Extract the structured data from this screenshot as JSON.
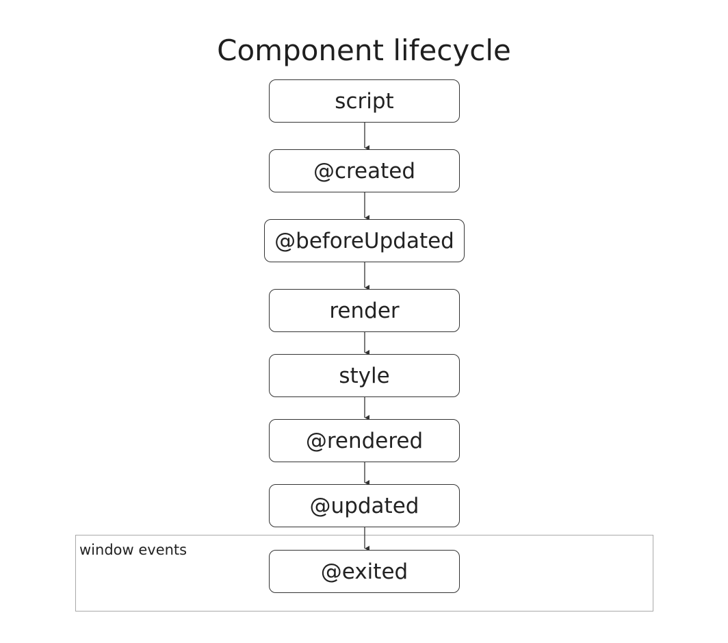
{
  "diagram": {
    "title": "Component lifecycle",
    "nodes": [
      {
        "id": "script",
        "label": "script"
      },
      {
        "id": "created",
        "label": "@created"
      },
      {
        "id": "beforeUpdated",
        "label": "@beforeUpdated"
      },
      {
        "id": "render",
        "label": "render"
      },
      {
        "id": "style",
        "label": "style"
      },
      {
        "id": "rendered",
        "label": "@rendered"
      },
      {
        "id": "updated",
        "label": "@updated"
      },
      {
        "id": "exited",
        "label": "@exited"
      }
    ],
    "edges": [
      {
        "from": "script",
        "to": "created"
      },
      {
        "from": "created",
        "to": "beforeUpdated"
      },
      {
        "from": "beforeUpdated",
        "to": "render"
      },
      {
        "from": "render",
        "to": "style"
      },
      {
        "from": "style",
        "to": "rendered"
      },
      {
        "from": "rendered",
        "to": "updated"
      },
      {
        "from": "updated",
        "to": "exited"
      }
    ],
    "group": {
      "label": "window events"
    },
    "colors": {
      "stroke": "#333333",
      "group_border": "#a8a8a8",
      "text": "#222222"
    }
  }
}
